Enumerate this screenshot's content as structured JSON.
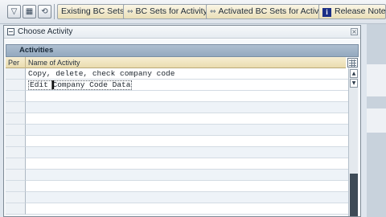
{
  "toolbar": {
    "icons": [
      "filter-icon",
      "layout-icon",
      "refresh-icon"
    ],
    "buttons": {
      "existing_bc_sets": "Existing BC Sets",
      "bc_sets_for_activity": "BC Sets for Activity",
      "activated_bc_sets_for_activity": "Activated BC Sets for Activity",
      "release_notes": "Release Notes"
    }
  },
  "dialog": {
    "title": "Choose Activity",
    "close_glyph": "×",
    "table": {
      "caption": "Activities",
      "columns": [
        "Per",
        "Name of Activity"
      ],
      "rows": [
        {
          "per": "",
          "name": "Copy, delete, check company code"
        },
        {
          "per": "",
          "name": "Edit Company Code Data"
        },
        {
          "per": "",
          "name": ""
        },
        {
          "per": "",
          "name": ""
        },
        {
          "per": "",
          "name": ""
        },
        {
          "per": "",
          "name": ""
        },
        {
          "per": "",
          "name": ""
        },
        {
          "per": "",
          "name": ""
        },
        {
          "per": "",
          "name": ""
        },
        {
          "per": "",
          "name": ""
        },
        {
          "per": "",
          "name": ""
        },
        {
          "per": "",
          "name": ""
        },
        {
          "per": "",
          "name": ""
        },
        {
          "per": "",
          "name": ""
        }
      ]
    },
    "scrollbar": {
      "up_glyph": "▲",
      "down_glyph": "▼"
    }
  }
}
